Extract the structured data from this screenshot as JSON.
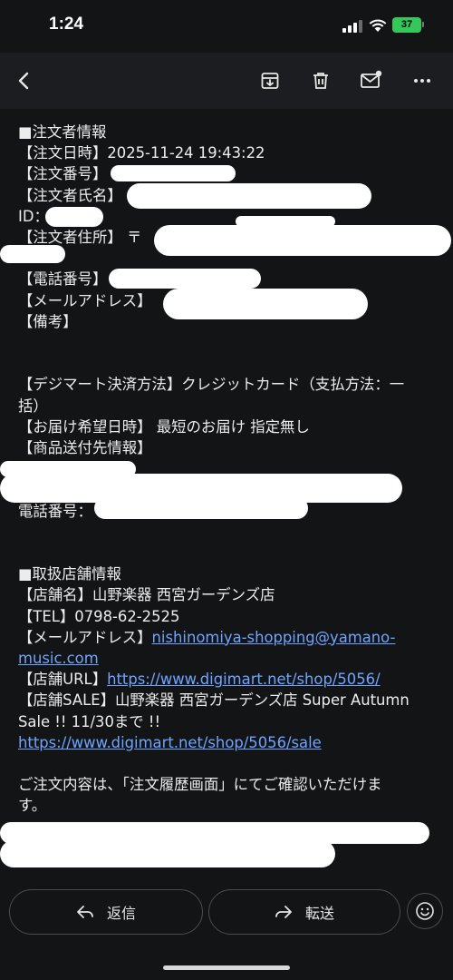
{
  "status_bar": {
    "time": "1:24",
    "battery": "37"
  },
  "toolbar": {
    "icons": [
      "back-arrow-icon",
      "archive-icon",
      "trash-icon",
      "mark-unread-icon",
      "more-icon"
    ]
  },
  "email": {
    "lines": [
      "■注文者情報",
      "【注文日時】2025-11-24 19:43:22",
      "【注文番号】",
      "【注文者氏名】                               （会員",
      "ID：",
      "【注文者住所】 〒",
      "",
      "【電話番号】",
      "【メールアドレス】",
      "【備考】",
      "",
      "",
      "【デジマート決済方法】クレジットカード（支払方法：一",
      "括）",
      "【お届け希望日時】 最短のお届け 指定無し",
      "【商品送付先情報】",
      "",
      "",
      "電話番号：",
      "",
      "",
      "■取扱店舗情報",
      "【店舗名】山野楽器 西宮ガーデンズ店",
      "【TEL】0798-62-2525"
    ],
    "mail_label": "【メールアドレス】",
    "mail_link_1": "nishinomiya-shopping@yamano-",
    "mail_link_2": "music.com",
    "url_label": "【店舗URL】",
    "url_link": "https://www.digimart.net/shop/5056/",
    "sale_line_1": "【店舗SALE】山野楽器 西宮ガーデンズ店 Super Autumn",
    "sale_line_2": "Sale !! 11/30まで !!",
    "sale_link": "https://www.digimart.net/shop/5056/sale",
    "footer_1": "ご注文内容は、「注文履歴画面」にてご確認いただけま",
    "footer_2": "す。"
  },
  "actions": {
    "reply_label": "返信",
    "forward_label": "転送"
  },
  "colors": {
    "background": "#131416",
    "toolbar": "#1c1d20",
    "link": "#6fa4ff",
    "battery": "#34c759"
  }
}
